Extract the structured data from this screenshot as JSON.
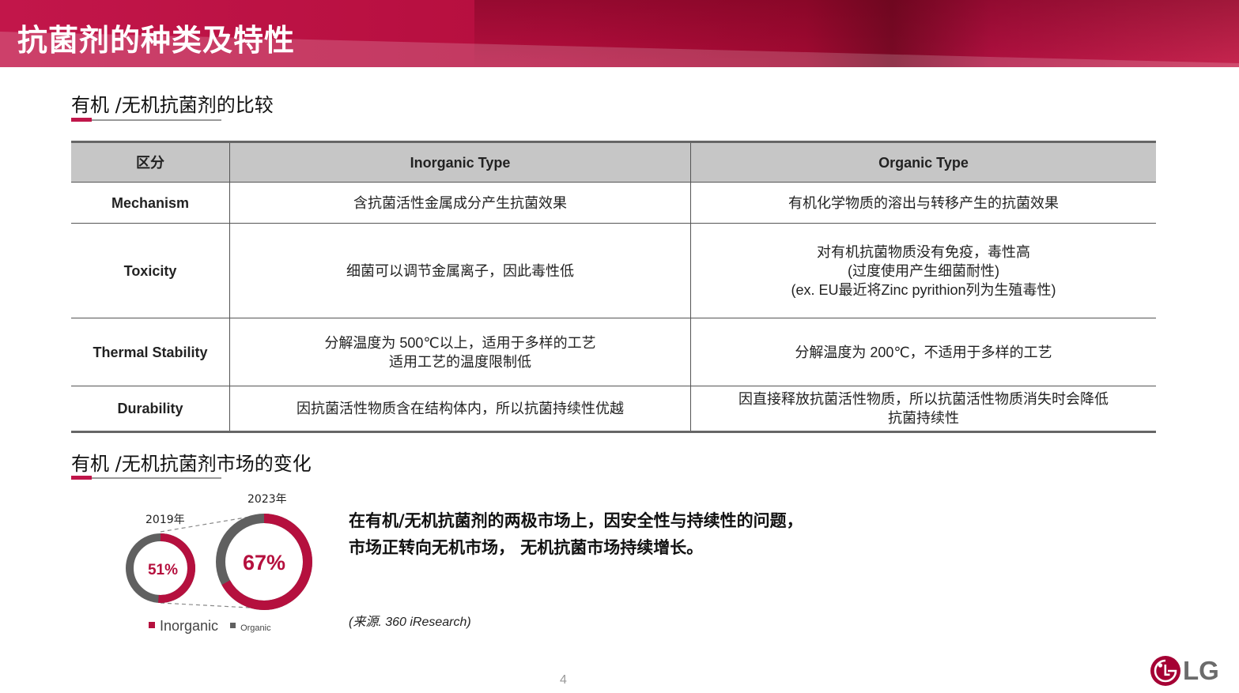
{
  "banner": {
    "title": "抗菌剂的种类及特性"
  },
  "section1": {
    "title": "有机 /无机抗菌剂的比较"
  },
  "table": {
    "headers": [
      "区分",
      "Inorganic Type",
      "Organic Type"
    ],
    "rows": [
      {
        "label": "Mechanism",
        "inorganic": [
          "含抗菌活性金属成分产生抗菌效果"
        ],
        "organic": [
          "有机化学物质的溶出与转移产生的抗菌效果"
        ]
      },
      {
        "label": "Toxicity",
        "inorganic": [
          "细菌可以调节金属离子，因此毒性低"
        ],
        "organic": [
          "对有机抗菌物质没有免疫，毒性高",
          "(过度使用产生细菌耐性)",
          "(ex. EU最近将Zinc pyrithion列为生殖毒性)"
        ]
      },
      {
        "label": "Thermal Stability",
        "inorganic": [
          "分解温度为 500℃以上，适用于多样的工艺",
          "适用工艺的温度限制低"
        ],
        "organic": [
          "分解温度为 200℃，不适用于多样的工艺"
        ]
      },
      {
        "label": "Durability",
        "inorganic": [
          "因抗菌活性物质含在结构体内，所以抗菌持续性优越"
        ],
        "organic": [
          "因直接释放抗菌活性物质，所以抗菌活性物质消失时会降低",
          "抗菌持续性"
        ]
      }
    ]
  },
  "section2": {
    "title": "有机 /无机抗菌剂市场的变化"
  },
  "market": {
    "chart_data": {
      "type": "pie",
      "charts": [
        {
          "year": "2019年",
          "inorganic": 51,
          "label": "51%"
        },
        {
          "year": "2023年",
          "inorganic": 67,
          "label": "67%"
        }
      ],
      "legend": [
        "Inorganic",
        "Organic"
      ],
      "colors": {
        "inorganic": "#b5103e",
        "organic": "#606060"
      }
    },
    "description": [
      "在有机/无机抗菌剂的两极市场上，因安全性与持续性的问题，",
      "市场正转向无机市场， 无机抗菌市场持续增长。"
    ],
    "source": "(来源. 360 iResearch)"
  },
  "footer": {
    "page": "4",
    "logo_text": "LG"
  }
}
